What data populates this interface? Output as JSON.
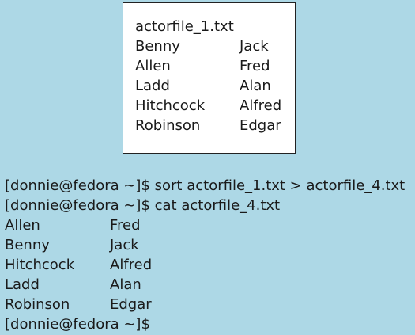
{
  "file_box": {
    "title": "actorfile_1.txt",
    "rows": [
      {
        "last": "Benny",
        "first": "Jack"
      },
      {
        "last": "Allen",
        "first": "Fred"
      },
      {
        "last": "Ladd",
        "first": "Alan"
      },
      {
        "last": "Hitchcock",
        "first": "Alfred"
      },
      {
        "last": "Robinson",
        "first": "Edgar"
      }
    ]
  },
  "terminal": {
    "commands": [
      "[donnie@fedora ~]$ sort actorfile_1.txt > actorfile_4.txt",
      "[donnie@fedora ~]$ cat actorfile_4.txt"
    ],
    "output": [
      {
        "last": "Allen",
        "first": "Fred"
      },
      {
        "last": "Benny",
        "first": "Jack"
      },
      {
        "last": "Hitchcock",
        "first": "Alfred"
      },
      {
        "last": "Ladd",
        "first": "Alan"
      },
      {
        "last": "Robinson",
        "first": "Edgar"
      }
    ],
    "prompt": "[donnie@fedora ~]$"
  }
}
